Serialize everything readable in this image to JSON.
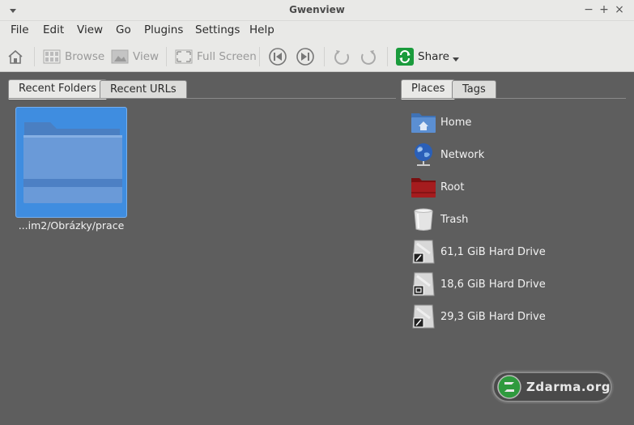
{
  "window": {
    "title": "Gwenview",
    "controls": [
      "minimize",
      "maximize",
      "close"
    ]
  },
  "menubar": {
    "items": [
      {
        "label": "File"
      },
      {
        "label": "Edit"
      },
      {
        "label": "View"
      },
      {
        "label": "Go"
      },
      {
        "label": "Plugins"
      },
      {
        "label": "Settings"
      },
      {
        "label": "Help"
      }
    ]
  },
  "toolbar": {
    "home_icon": "home-icon",
    "browse": {
      "label": "Browse",
      "enabled": false
    },
    "view": {
      "label": "View",
      "enabled": false
    },
    "fullscreen": {
      "label": "Full Screen",
      "enabled": false
    },
    "previous_icon": "previous-icon",
    "next_icon": "next-icon",
    "rotate_left_icon": "rotate-left-icon",
    "rotate_right_icon": "rotate-right-icon",
    "share": {
      "label": "Share",
      "enabled": true,
      "accent": "#1a9b3c"
    }
  },
  "left_pane": {
    "tabs": [
      {
        "label": "Recent Folders",
        "active": true
      },
      {
        "label": "Recent URLs",
        "active": false
      }
    ],
    "folders": [
      {
        "label": "...im2/Obrázky/prace",
        "selected": true
      }
    ]
  },
  "right_pane": {
    "tabs": [
      {
        "label": "Places",
        "active": true
      },
      {
        "label": "Tags",
        "active": false
      }
    ],
    "places": [
      {
        "label": "Home",
        "icon": "home-folder-icon"
      },
      {
        "label": "Network",
        "icon": "network-globe-icon"
      },
      {
        "label": "Root",
        "icon": "red-folder-icon"
      },
      {
        "label": "Trash",
        "icon": "trash-icon"
      },
      {
        "label": "61,1 GiB Hard Drive",
        "icon": "hard-drive-icon"
      },
      {
        "label": "18,6 GiB Hard Drive",
        "icon": "hard-drive-icon"
      },
      {
        "label": "29,3 GiB Hard Drive",
        "icon": "hard-drive-icon"
      }
    ]
  },
  "watermark": {
    "text": "Zdarma.org"
  },
  "colors": {
    "chrome": "#e9e9e7",
    "background": "#5e5e5e",
    "selection": "#3f8de0",
    "share_green": "#1a9b3c"
  }
}
